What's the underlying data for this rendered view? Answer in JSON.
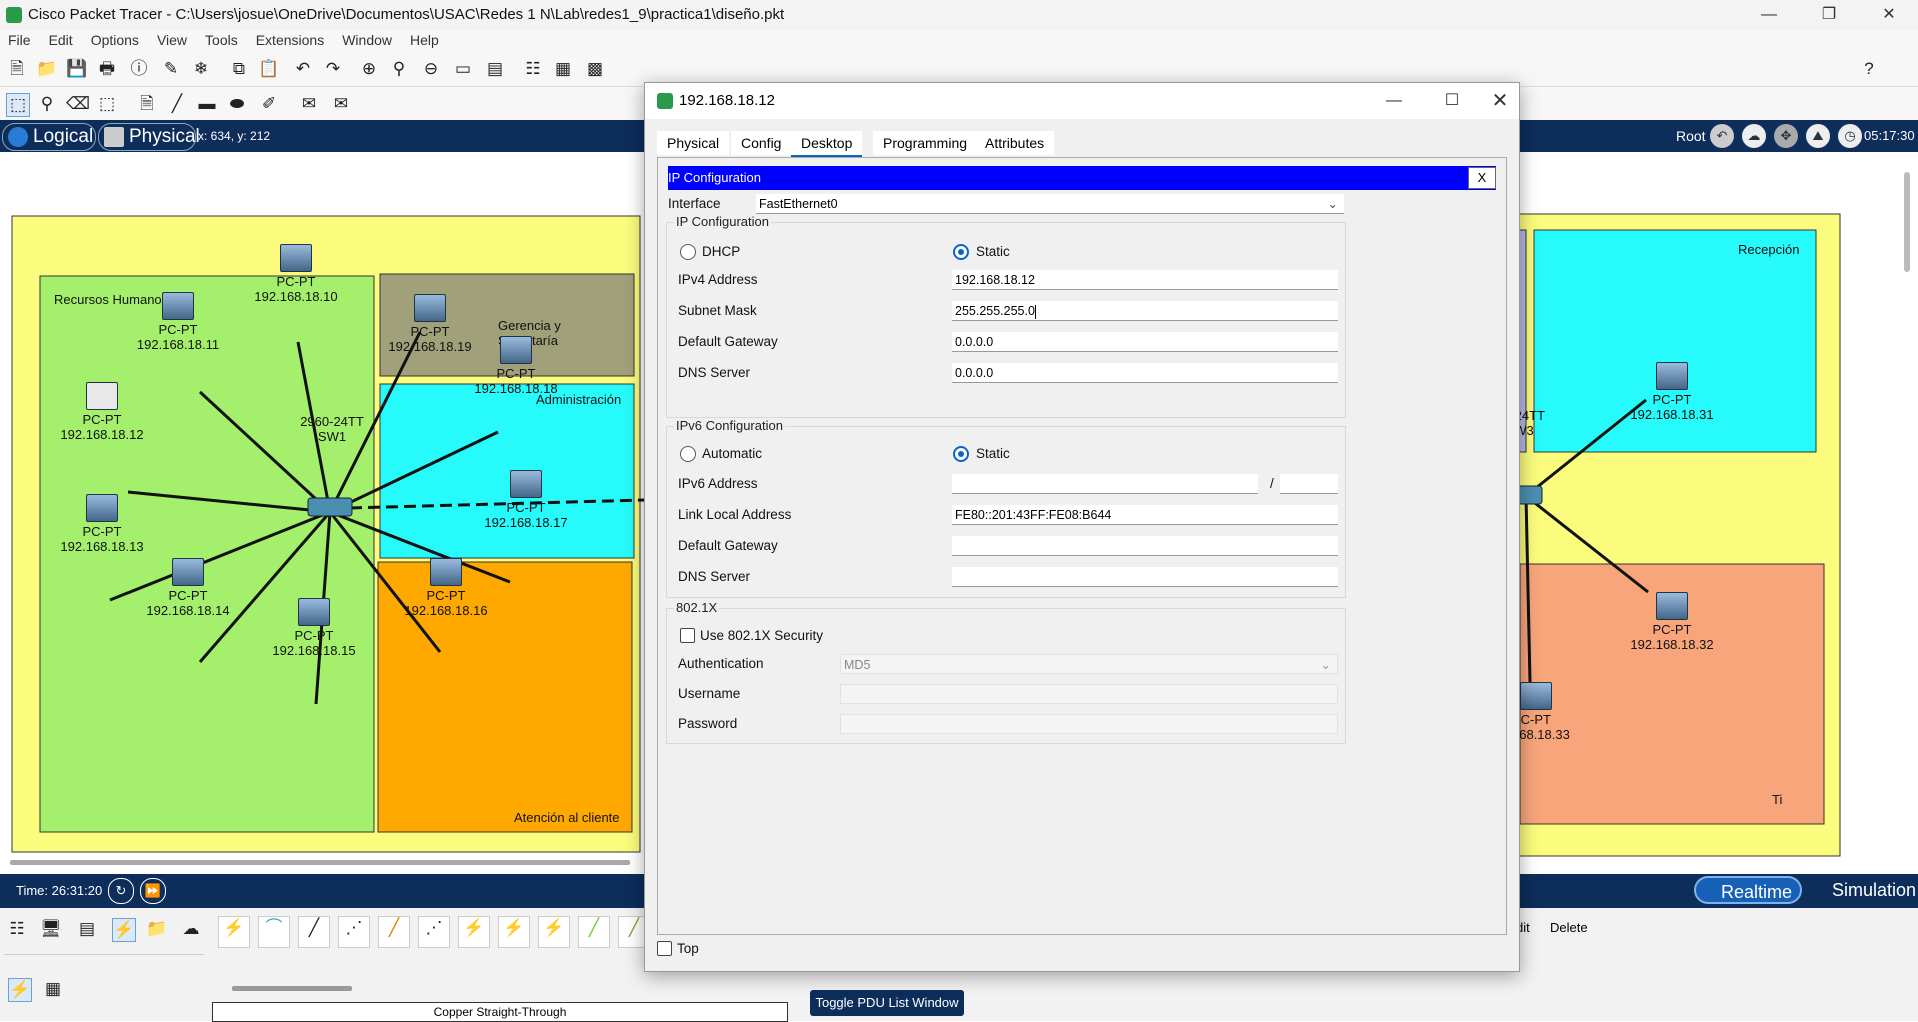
{
  "app": {
    "title": "Cisco Packet Tracer - C:\\Users\\josue\\OneDrive\\Documentos\\USAC\\Redes 1 N\\Lab\\redes1_9\\practica1\\diseño.pkt"
  },
  "menu": [
    "File",
    "Edit",
    "Options",
    "View",
    "Tools",
    "Extensions",
    "Window",
    "Help"
  ],
  "modes": {
    "logical": "Logical",
    "physical": "Physical",
    "coords": "x: 634, y: 212",
    "root": "Root",
    "clock": "05:17:30"
  },
  "workspace": {
    "zones": {
      "rrhh": "Recursos Humanos",
      "gerencia": "Gerencia y\nSecretaría",
      "admin": "Administración",
      "atencion": "Atención al cliente",
      "recepcion": "Recepción",
      "ti": "Ti"
    },
    "switch": {
      "model": "2960-24TT",
      "name": "SW1"
    },
    "switch3": {
      "model": "0-24TT",
      "name": "W3"
    },
    "pcs": [
      {
        "type": "PC-PT",
        "ip": "192.168.18.10"
      },
      {
        "type": "PC-PT",
        "ip": "192.168.18.11"
      },
      {
        "type": "PC-PT",
        "ip": "192.168.18.12"
      },
      {
        "type": "PC-PT",
        "ip": "192.168.18.13"
      },
      {
        "type": "PC-PT",
        "ip": "192.168.18.14"
      },
      {
        "type": "PC-PT",
        "ip": "192.168.18.15"
      },
      {
        "type": "PC-PT",
        "ip": "192.168.18.16"
      },
      {
        "type": "PC-PT",
        "ip": "192.168.18.17"
      },
      {
        "type": "PC-PT",
        "ip": "192.168.18.18"
      },
      {
        "type": "PC-PT",
        "ip": "192.168.18.19"
      },
      {
        "type": "PC-PT",
        "ip": "192.168.18.31"
      },
      {
        "type": "PC-PT",
        "ip": "192.168.18.32"
      },
      {
        "type": "PC-PT",
        "ip": "168.18.33"
      }
    ]
  },
  "timebar": {
    "time": "Time: 26:31:20",
    "realtime": "Realtime",
    "simulation": "Simulation"
  },
  "bottom": {
    "cable_name": "Copper Straight-Through",
    "toggle_pdu": "Toggle PDU List Window",
    "edit": "dit",
    "delete": "Delete"
  },
  "dialog": {
    "title": "192.168.18.12",
    "tabs": [
      "Physical",
      "Config",
      "Desktop",
      "Programming",
      "Attributes"
    ],
    "active_tab": "Desktop",
    "header": "IP Configuration",
    "close_x": "X",
    "interface_label": "Interface",
    "interface_value": "FastEthernet0",
    "ipv4": {
      "group": "IP Configuration",
      "dhcp": "DHCP",
      "static": "Static",
      "ipv4_label": "IPv4 Address",
      "ipv4_value": "192.168.18.12",
      "mask_label": "Subnet Mask",
      "mask_value": "255.255.255.0",
      "gw_label": "Default Gateway",
      "gw_value": "0.0.0.0",
      "dns_label": "DNS Server",
      "dns_value": "0.0.0.0"
    },
    "ipv6": {
      "group": "IPv6 Configuration",
      "automatic": "Automatic",
      "static": "Static",
      "addr_label": "IPv6 Address",
      "slash": "/",
      "lla_label": "Link Local Address",
      "lla_value": "FE80::201:43FF:FE08:B644",
      "gw_label": "Default Gateway",
      "dns_label": "DNS Server"
    },
    "dot1x": {
      "group": "802.1X",
      "use": "Use 802.1X Security",
      "auth_label": "Authentication",
      "auth_value": "MD5",
      "user_label": "Username",
      "pass_label": "Password"
    },
    "top_label": "Top"
  },
  "colors": {
    "blue_bar": "#0d2d5b",
    "yellow": "#fbfb7d",
    "green": "#a4f06c",
    "olive": "#a0a07a",
    "cyan": "#27fafa",
    "orange": "#ffa800",
    "salmon": "#f8a57b",
    "ip_header": "#0000ff"
  }
}
